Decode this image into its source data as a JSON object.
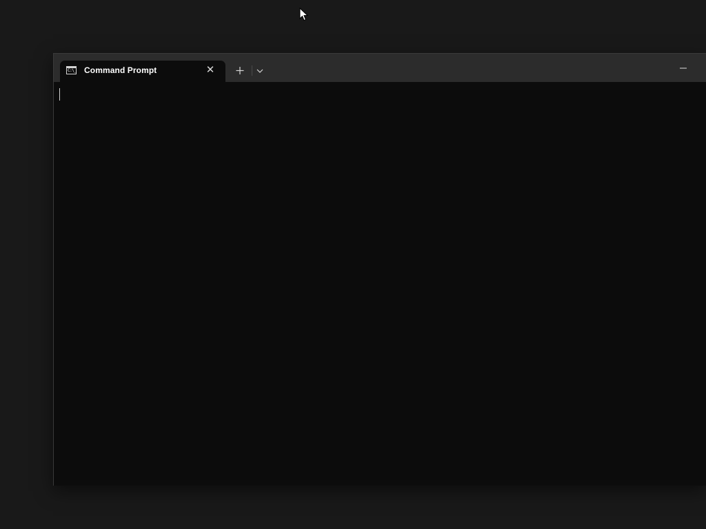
{
  "window": {
    "tab_title": "Command Prompt",
    "tab_icon": "command-prompt-icon",
    "tab_icon_text": "C:\\_"
  },
  "toolbar": {
    "new_tab_icon": "plus-icon",
    "dropdown_icon": "chevron-down-icon",
    "close_tab_icon": "close-icon",
    "minimize_icon": "minimize-icon",
    "close_glyph": "✕"
  },
  "terminal": {
    "content": ""
  },
  "colors": {
    "desktop": "#191919",
    "titlebar": "#2c2c2c",
    "terminal_bg": "#0c0c0c",
    "text": "#ffffff"
  }
}
